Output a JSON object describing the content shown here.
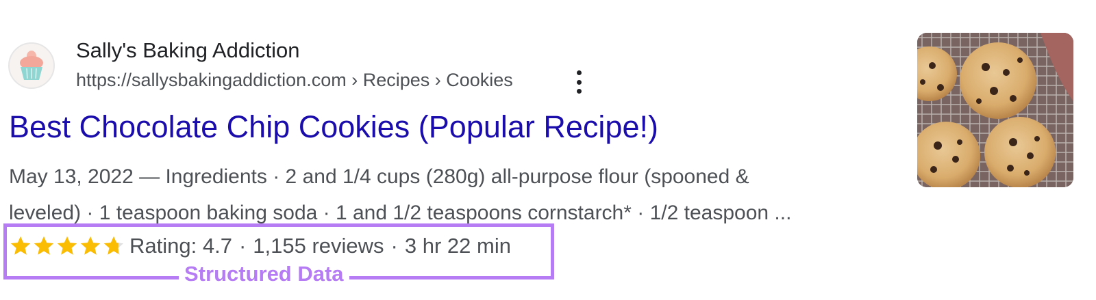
{
  "site": {
    "name": "Sally's Baking Addiction",
    "breadcrumb": "https://sallysbakingaddiction.com › Recipes › Cookies",
    "favicon_icon": "cupcake-icon"
  },
  "result": {
    "title": "Best Chocolate Chip Cookies (Popular Recipe!)",
    "snippet_line1": "May 13, 2022 — Ingredients · 2 and 1/4 cups (280g) all-purpose flour (spooned &",
    "snippet_line2": "leveled) · 1 teaspoon baking soda · 1 and 1/2 teaspoons cornstarch* · 1/2 teaspoon ..."
  },
  "rich_result": {
    "rating_value": 4.7,
    "rating_max": 5,
    "rating_text": "Rating: 4.7",
    "reviews_text": "1,155 reviews",
    "time_text": "3 hr 22 min",
    "separator": "·",
    "star_color": "#fbbc04"
  },
  "annotation": {
    "label": "Structured Data",
    "color": "#b57cf4"
  },
  "colors": {
    "link": "#1a0dab",
    "text": "#4d5156",
    "heading": "#202124"
  },
  "thumbnail": {
    "icon": "chocolate-chip-cookies-image"
  }
}
